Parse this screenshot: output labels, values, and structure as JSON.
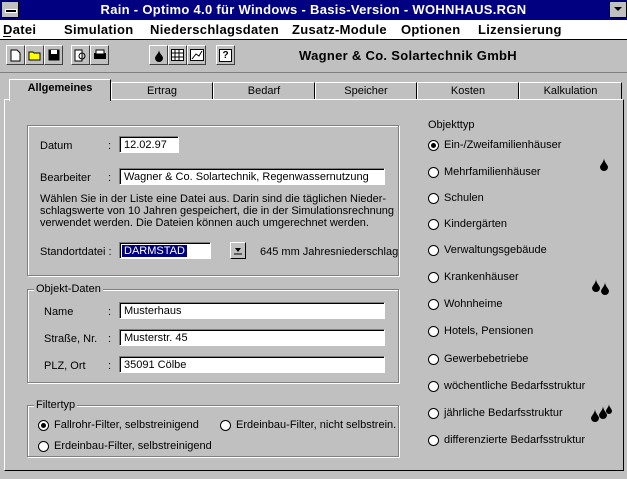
{
  "window": {
    "title": "Rain - Optimo 4.0 für Windows - Basis-Version - WOHNHAUS.RGN"
  },
  "menu": [
    "Datei",
    "Simulation",
    "Niederschlagsdaten",
    "Zusatz-Module",
    "Optionen",
    "Lizensierung"
  ],
  "toolbar": {
    "company": "Wagner & Co. Solartechnik GmbH",
    "buttons": [
      "new-icon",
      "open-icon",
      "save-icon",
      "print-preview-icon",
      "print-icon",
      "rain-icon",
      "table-icon",
      "chart-icon",
      "help-icon"
    ],
    "help_glyph": "?"
  },
  "tabs": [
    "Allgemeines",
    "Ertrag",
    "Bedarf",
    "Speicher",
    "Kosten",
    "Kalkulation"
  ],
  "general": {
    "datum_label": "Datum",
    "datum": "12.02.97",
    "bearbeiter_label": "Bearbeiter",
    "bearbeiter": "Wagner & Co. Solartechnik, Regenwassernutzung",
    "colon": ":",
    "description": [
      "Wählen Sie in der Liste eine Datei aus. Darin sind die täglichen Nieder-",
      "schlagswerte von 10 Jahren gespeichert, die in der Simulationsrechnung",
      "verwendet werden. Die Dateien können auch umgerechnet werden."
    ],
    "standort_label": "Standortdatei :",
    "standort": "DARMSTAD",
    "niederschlag": "645 mm Jahresniederschlag"
  },
  "objekt_daten": {
    "title": "Objekt-Daten",
    "name_label": "Name",
    "name": "Musterhaus",
    "strasse_label": "Straße, Nr.",
    "strasse": "Musterstr. 45",
    "plz_label": "PLZ, Ort",
    "plz": "35091 Cölbe"
  },
  "filtertyp": {
    "title": "Filtertyp",
    "options": [
      "Fallrohr-Filter, selbstreinigend",
      "Erdeinbau-Filter, nicht selbstrein.",
      "Erdeinbau-Filter, selbstreinigend"
    ],
    "selected": 0
  },
  "objekttyp": {
    "title": "Objekttyp",
    "options": [
      "Ein-/Zweifamilienhäuser",
      "Mehrfamilienhäuser",
      "Schulen",
      "Kindergärten",
      "Verwaltungsgebäude",
      "Krankenhäuser",
      "Wohnheime",
      "Hotels, Pensionen",
      "Gewerbebetriebe",
      "wöchentliche Bedarfsstruktur",
      "jährliche Bedarfsstruktur",
      "differenzierte Bedarfsstruktur"
    ],
    "selected": 0
  },
  "colors": {
    "titlebar": "#000080",
    "face": "#c0c0c0"
  }
}
